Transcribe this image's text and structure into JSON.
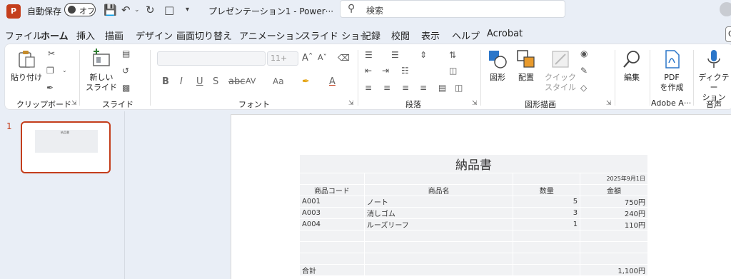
{
  "titlebar": {
    "logo_letter": "P",
    "autosave_label": "自動保存",
    "autosave_state": "オフ",
    "doc_title": "プレゼンテーション1  -  Power···",
    "search_placeholder": "検索"
  },
  "tabs": [
    {
      "label": "ファイル"
    },
    {
      "label": "ホーム"
    },
    {
      "label": "挿入"
    },
    {
      "label": "描画"
    },
    {
      "label": "デザイン"
    },
    {
      "label": "画面切り替え"
    },
    {
      "label": "アニメーション"
    },
    {
      "label": "スライド ショー"
    },
    {
      "label": "記録"
    },
    {
      "label": "校閲"
    },
    {
      "label": "表示"
    },
    {
      "label": "ヘルプ"
    },
    {
      "label": "Acrobat"
    }
  ],
  "active_tab": "ホーム",
  "ribbon": {
    "paste_label": "貼り付け",
    "clipboard_group": "クリップボード",
    "new_slide_label_1": "新しい",
    "new_slide_label_2": "スライド",
    "slide_group": "スライド",
    "font_size": "11+",
    "font_group": "フォント",
    "paragraph_group": "段落",
    "shape_label": "図形",
    "arrange_label": "配置",
    "quick_style_1": "クイック",
    "quick_style_2": "スタイル",
    "drawing_group": "図形描画",
    "edit_label": "編集",
    "pdf_label_1": "PDF",
    "pdf_label_2": "を作成",
    "adobe_group": "Adobe A···",
    "dictate_label_1": "ディクテー",
    "dictate_label_2": "ション",
    "voice_group": "音声"
  },
  "thumbnail": {
    "number": "1",
    "title": "納品書"
  },
  "invoice": {
    "title": "納品書",
    "date": "2025年9月1日",
    "headers": [
      "商品コード",
      "商品名",
      "数量",
      "金額"
    ],
    "rows": [
      {
        "code": "A001",
        "name": "ノート",
        "qty": "5",
        "amount": "750円"
      },
      {
        "code": "A003",
        "name": "消しゴム",
        "qty": "3",
        "amount": "240円"
      },
      {
        "code": "A004",
        "name": "ルーズリーフ",
        "qty": "1",
        "amount": "110円"
      }
    ],
    "total_label": "合計",
    "total_amount": "1,100円"
  },
  "colors": {
    "accent": "#c43e1c",
    "background": "#e9eef6",
    "table_fill": "#f1f2f4"
  }
}
